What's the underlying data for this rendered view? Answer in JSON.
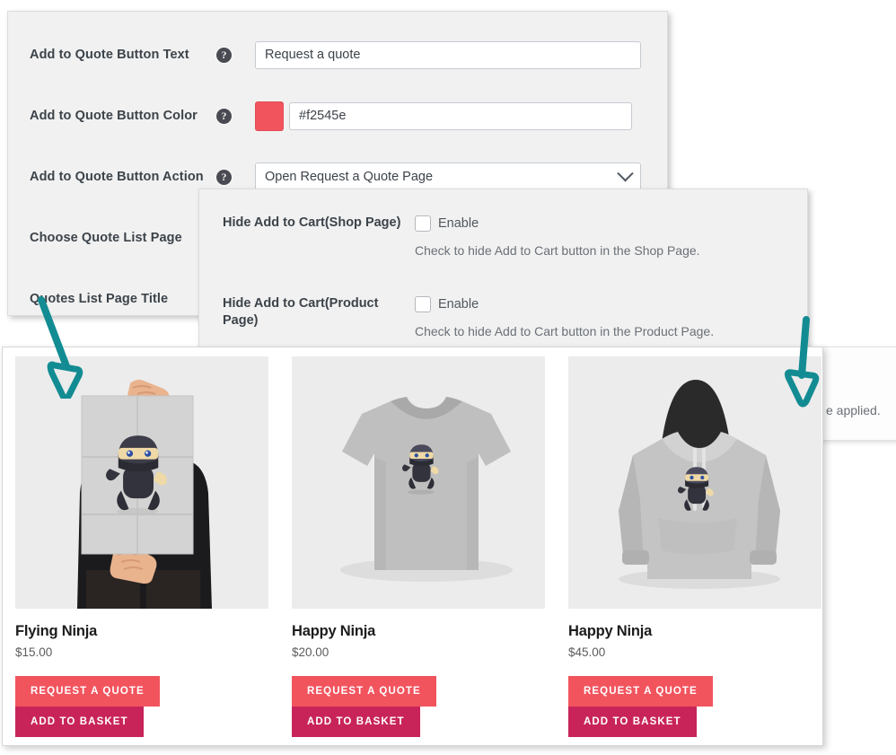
{
  "settings_panel": {
    "rows": [
      {
        "label": "Add to Quote Button Text",
        "help": "?",
        "value": "Request a quote",
        "placeholder": "Request a quote"
      },
      {
        "label": "Add to Quote Button Color",
        "help": "?",
        "value": "#f2545e",
        "placeholder": "#f2545e",
        "swatch_color": "#f2545e"
      },
      {
        "label": "Add to Quote Button Action",
        "help": "?",
        "value": "Open Request a Quote Page"
      },
      {
        "label": "Choose Quote List Page"
      },
      {
        "label": "Quotes List Page Title"
      }
    ]
  },
  "hide_cart_panel": {
    "rows": [
      {
        "label": "Hide Add to Cart(Shop Page)",
        "enable_label": "Enable",
        "hint": "Check to hide Add to Cart button in the Shop Page.",
        "checked": false
      },
      {
        "label": "Hide Add to Cart(Product Page)",
        "enable_label": "Enable",
        "hint": "Check to hide Add to Cart button in the Product Page.",
        "checked": false
      }
    ]
  },
  "behind_panel": {
    "text_fragment": "e applied."
  },
  "shop": {
    "quote_button_label": "REQUEST A QUOTE",
    "cart_button_label": "ADD TO BASKET",
    "quote_button_color": "#f2545e",
    "cart_button_color": "#c8245a",
    "products": [
      {
        "title": "Flying Ninja",
        "price": "$15.00",
        "image": "ninja-poster-image"
      },
      {
        "title": "Happy Ninja",
        "price": "$20.00",
        "image": "ninja-tshirt-image"
      },
      {
        "title": "Happy Ninja",
        "price": "$45.00",
        "image": "ninja-hoodie-image"
      }
    ]
  },
  "annotations": {
    "arrow_color": "#128c92",
    "arrows": [
      {
        "name": "arrow-left-pointing-to-product-1"
      },
      {
        "name": "arrow-right-pointing-to-product-3"
      }
    ]
  }
}
